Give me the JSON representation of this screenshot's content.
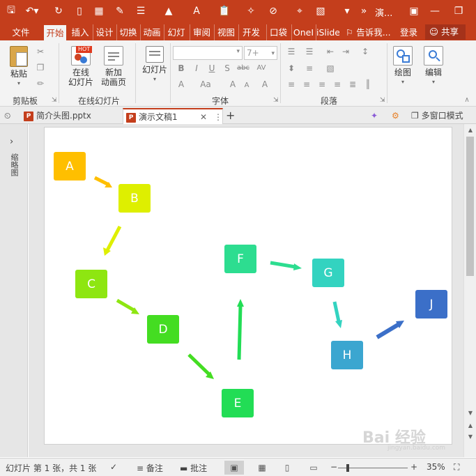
{
  "app": {
    "doc_title": "演...",
    "colors": {
      "brand": "#c43e1c",
      "ribbon_bg": "#f3f3f3"
    }
  },
  "ribbon": {
    "tabs": [
      "文件",
      "开始",
      "插入",
      "设计",
      "切换",
      "动画",
      "幻灯片",
      "审阅",
      "视图",
      "开发",
      "口袋",
      "OneI",
      "iSlide",
      "告诉我..."
    ],
    "active_tab": "开始",
    "signin": "登录",
    "share": "共享",
    "groups": {
      "clipboard": {
        "paste": "粘贴",
        "label": "剪贴板"
      },
      "online_slides": {
        "online": "在线\n幻灯片",
        "online_1": "在线",
        "online_2": "幻灯片",
        "new_1": "新加",
        "new_2": "动画页",
        "label": "在线幻灯片",
        "hot": "HOT"
      },
      "slides": {
        "label_btn": "幻灯片"
      },
      "font": {
        "label": "字体",
        "size": "7+",
        "bold": "B",
        "italic": "I",
        "underline": "U",
        "shadow": "S",
        "strike": "abc",
        "spacing": "AV",
        "font_color": "A",
        "case": "Aa",
        "grow": "A",
        "shrink": "A",
        "clear": "A"
      },
      "paragraph": {
        "label": "段落"
      },
      "drawing": {
        "label": "绘图"
      },
      "editing": {
        "label": "编辑"
      }
    }
  },
  "doc_tabs": [
    {
      "name": "简介头图.pptx",
      "active": false
    },
    {
      "name": "演示文稿1",
      "active": true
    }
  ],
  "doc_tab_actions": {
    "add": "+",
    "multiwindow": "多窗口模式"
  },
  "left_pane": {
    "label": "缩略图"
  },
  "slide": {
    "nodes": [
      {
        "label": "A",
        "color": "#ffbf00"
      },
      {
        "label": "B",
        "color": "#deef00"
      },
      {
        "label": "C",
        "color": "#8ee611"
      },
      {
        "label": "D",
        "color": "#44dd22"
      },
      {
        "label": "E",
        "color": "#22dd55"
      },
      {
        "label": "F",
        "color": "#2ddd90"
      },
      {
        "label": "G",
        "color": "#33d3c0"
      },
      {
        "label": "H",
        "color": "#3ba6d0"
      },
      {
        "label": "J",
        "color": "#3b6fc8"
      }
    ]
  },
  "status": {
    "slide_info": "幻灯片 第 1 张，共 1 张",
    "notes": "备注",
    "comments": "批注",
    "zoom": "35%"
  },
  "watermark": {
    "brand": "Bai 经验",
    "url": "jingyan.baidu.com"
  }
}
